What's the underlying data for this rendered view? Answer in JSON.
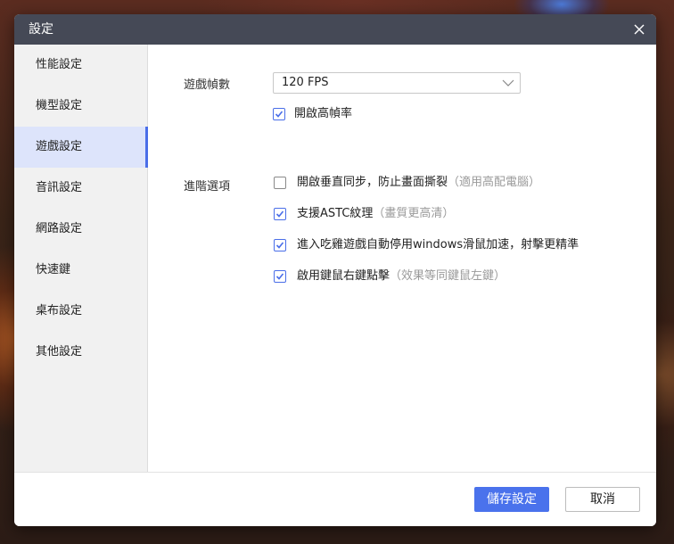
{
  "window": {
    "title": "設定"
  },
  "sidebar": {
    "items": [
      {
        "label": "性能設定",
        "active": false
      },
      {
        "label": "機型設定",
        "active": false
      },
      {
        "label": "遊戲設定",
        "active": true
      },
      {
        "label": "音訊設定",
        "active": false
      },
      {
        "label": "網路設定",
        "active": false
      },
      {
        "label": "快速鍵",
        "active": false
      },
      {
        "label": "桌布設定",
        "active": false
      },
      {
        "label": "其他設定",
        "active": false
      }
    ]
  },
  "game": {
    "fps_label": "遊戲幀數",
    "fps_value": "120 FPS",
    "high_fps": {
      "label": "開啟高幀率",
      "checked": true
    },
    "advanced_label": "進階選項",
    "options": [
      {
        "label": "開啟垂直同步，防止畫面撕裂",
        "hint": "（適用高配電腦）",
        "checked": false
      },
      {
        "label": "支援ASTC紋理",
        "hint": "（畫質更高清）",
        "checked": true
      },
      {
        "label": "進入吃雞遊戲自動停用windows滑鼠加速，射擊更精準",
        "hint": "",
        "checked": true
      },
      {
        "label": "啟用鍵鼠右鍵點擊",
        "hint": "（效果等同鍵鼠左鍵）",
        "checked": true
      }
    ]
  },
  "footer": {
    "save_label": "儲存設定",
    "cancel_label": "取消"
  },
  "colors": {
    "accent": "#4a72ec",
    "titlebar": "#454956",
    "sidebar_active": "#dde4fb"
  },
  "icons": {
    "close": "close-icon",
    "dropdown": "chevron-down-icon",
    "check": "checkmark-icon"
  }
}
